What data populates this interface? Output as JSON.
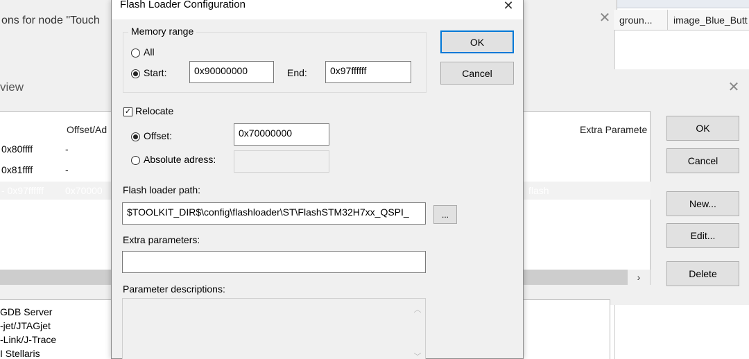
{
  "background": {
    "options_window_title": "ons for node \"Touch",
    "right_tabs": [
      "groun...",
      "image_Blue_Butt"
    ],
    "overview_title": "view",
    "table": {
      "headers": {
        "offset": "Offset/Ad",
        "extra": "Extra Paramete"
      },
      "rows": [
        {
          "range": "0x80ffff",
          "offset": "-"
        },
        {
          "range": "0x81ffff",
          "offset": "-"
        },
        {
          "range": "- 0x97ffffff",
          "offset": "0x70000",
          "extra": "flash"
        }
      ]
    },
    "side_buttons": {
      "ok": "OK",
      "cancel": "Cancel",
      "new": "New...",
      "edit": "Edit...",
      "delete": "Delete"
    },
    "scroll_right": "›",
    "drivers": [
      "GDB Server",
      "-jet/JTAGjet",
      "-Link/J-Trace",
      "I Stellaris"
    ]
  },
  "dialog": {
    "title": "Flash Loader Configuration",
    "close": "✕",
    "memory_range": {
      "legend": "Memory range",
      "all_label": "All",
      "start_label": "Start:",
      "start_value": "0x90000000",
      "end_label": "End:",
      "end_value": "0x97ffffff",
      "selected": "start"
    },
    "relocate": {
      "label": "Relocate",
      "checked": true,
      "offset_label": "Offset:",
      "offset_value": "0x70000000",
      "absolute_label": "Absolute adress:",
      "absolute_value": "",
      "selected": "offset"
    },
    "flash_loader_path_label": "Flash loader path:",
    "flash_loader_path": "$TOOLKIT_DIR$\\config\\flashloader\\ST\\FlashSTM32H7xx_QSPI_",
    "browse_label": "...",
    "extra_parameters_label": "Extra parameters:",
    "extra_parameters_value": "",
    "parameter_descriptions_label": "Parameter descriptions:",
    "ok_label": "OK",
    "cancel_label": "Cancel"
  },
  "colors": {
    "default_button_border": "#0078d7",
    "dialog_bg": "#f0f0f0"
  },
  "icons": {
    "close": "close-icon",
    "checkbox": "checkmark-icon"
  }
}
